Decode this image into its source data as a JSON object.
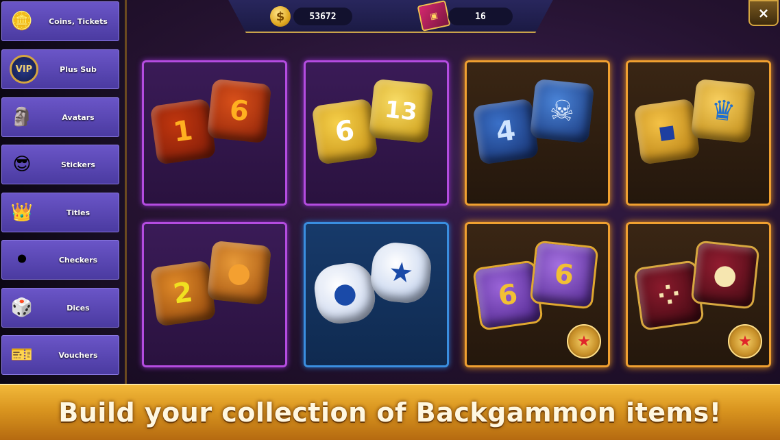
{
  "header": {
    "coins_value": "53672",
    "tickets_value": "16",
    "coin_symbol": "$",
    "close_symbol": "×"
  },
  "sidebar": {
    "items": [
      {
        "label": "Coins, Tickets",
        "icon": "coins-icon",
        "glyph": "🪙"
      },
      {
        "label": "Plus Sub",
        "icon": "vip-badge-icon",
        "glyph": "VIP"
      },
      {
        "label": "Avatars",
        "icon": "avatar-figure-icon",
        "glyph": "🗿"
      },
      {
        "label": "Stickers",
        "icon": "sunglasses-emoji-icon",
        "glyph": "😎"
      },
      {
        "label": "Titles",
        "icon": "crown-banner-icon",
        "glyph": "👑"
      },
      {
        "label": "Checkers",
        "icon": "checkers-icon",
        "glyph": "⚫"
      },
      {
        "label": "Dices",
        "icon": "dice-icon",
        "glyph": "🎲"
      },
      {
        "label": "Vouchers",
        "icon": "voucher-icon",
        "glyph": "🎫"
      }
    ]
  },
  "cards": [
    {
      "name": "lava-dice",
      "style": "purple",
      "die1": "1",
      "die2": "6",
      "c1": "#7a1a08",
      "c2": "#c0360e",
      "text": "#ffb020"
    },
    {
      "name": "gold-dice",
      "style": "purple",
      "die1": "6",
      "die2": "13",
      "c1": "#d9a514",
      "c2": "#f2c63a",
      "text": "#ffffff"
    },
    {
      "name": "skull-ice-dice",
      "style": "gold",
      "die1": "4",
      "die2": "☠",
      "c1": "#1d3e8a",
      "c2": "#3a70c8",
      "text": "#cfe4ff"
    },
    {
      "name": "royal-dice",
      "style": "gold",
      "die1": "▪",
      "die2": "♛",
      "c1": "#d99a20",
      "c2": "#f0b838",
      "text": "#1e3fa0"
    },
    {
      "name": "basketball-dice",
      "style": "purple",
      "die1": "2",
      "die2": "●",
      "c1": "#b45a10",
      "c2": "#d27a1c",
      "text": "#f0e020"
    },
    {
      "name": "star-dice",
      "style": "blue",
      "die1": "●",
      "die2": "★",
      "c1": "#e8eef8",
      "c2": "#cfdcf0",
      "text": "#1a4aa8"
    },
    {
      "name": "purple-gold-dice",
      "style": "gold",
      "die1": "6",
      "die2": "6",
      "c1": "#6a3aa8",
      "c2": "#8a54c8",
      "text": "#f2c034",
      "medal": "★"
    },
    {
      "name": "ruby-dice",
      "style": "gold",
      "die1": "⁘",
      "die2": "●",
      "c1": "#5a0e1a",
      "c2": "#7a1424",
      "text": "#f6e6b0",
      "medal": "★"
    }
  ],
  "banner": {
    "text": "Build your collection of Backgammon items!"
  }
}
